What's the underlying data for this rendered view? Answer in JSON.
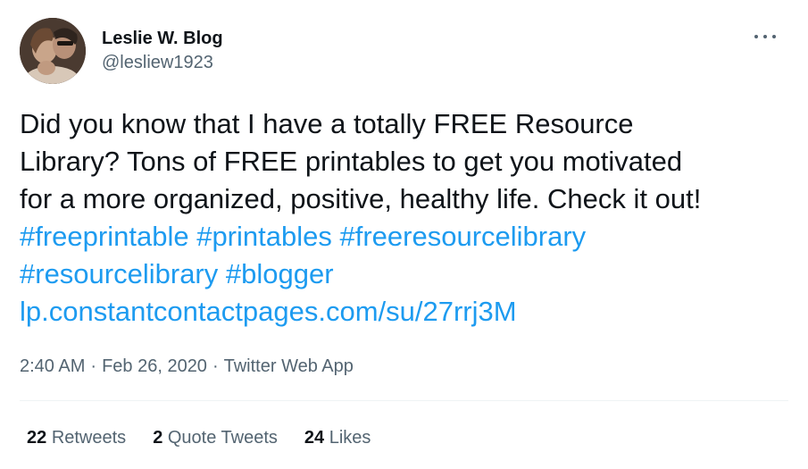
{
  "author": {
    "display_name": "Leslie W. Blog",
    "handle": "@lesliew1923"
  },
  "tweet": {
    "text_lines": [
      "Did you know that I have a totally FREE Resource",
      "Library? Tons of FREE printables to get you motivated",
      "for a more organized, positive, healthy life. Check it out!"
    ],
    "hashtags": [
      "#freeprintable",
      "#printables",
      "#freeresourcelibrary",
      "#resourcelibrary",
      "#blogger"
    ],
    "link": "lp.constantcontactpages.com/su/27rrj3M"
  },
  "meta": {
    "time": "2:40 AM",
    "separator": "·",
    "date": "Feb 26, 2020",
    "source": "Twitter Web App"
  },
  "stats": {
    "retweets_count": "22",
    "retweets_label": "Retweets",
    "quotes_count": "2",
    "quotes_label": "Quote Tweets",
    "likes_count": "24",
    "likes_label": "Likes"
  },
  "icons": {
    "more": "more-horizontal-icon"
  },
  "colors": {
    "link": "#1d9bf0",
    "text": "#0f1419",
    "secondary": "#536471"
  }
}
